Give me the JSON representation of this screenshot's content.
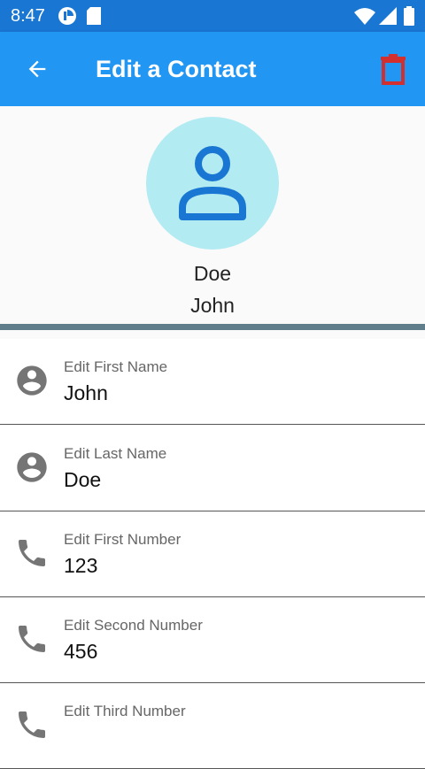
{
  "status_bar": {
    "time": "8:47",
    "icons": [
      "pie-progress-icon",
      "sd-card-icon",
      "wifi-icon",
      "signal-icon",
      "battery-icon"
    ]
  },
  "app_bar": {
    "title": "Edit a Contact",
    "background": "#2196f3",
    "delete_icon_color": "#d32f2f"
  },
  "header": {
    "last_name": "Doe",
    "first_name": "John",
    "avatar_bg": "#b2ebf2",
    "avatar_icon_color": "#1976d2"
  },
  "fields": [
    {
      "label": "Edit First Name",
      "value": "John",
      "icon": "account-circle-icon"
    },
    {
      "label": "Edit Last Name",
      "value": "Doe",
      "icon": "account-circle-icon"
    },
    {
      "label": "Edit First Number",
      "value": "123",
      "icon": "phone-icon"
    },
    {
      "label": "Edit Second Number",
      "value": "456",
      "icon": "phone-icon"
    },
    {
      "label": "Edit Third Number",
      "value": "",
      "icon": "phone-icon"
    }
  ]
}
